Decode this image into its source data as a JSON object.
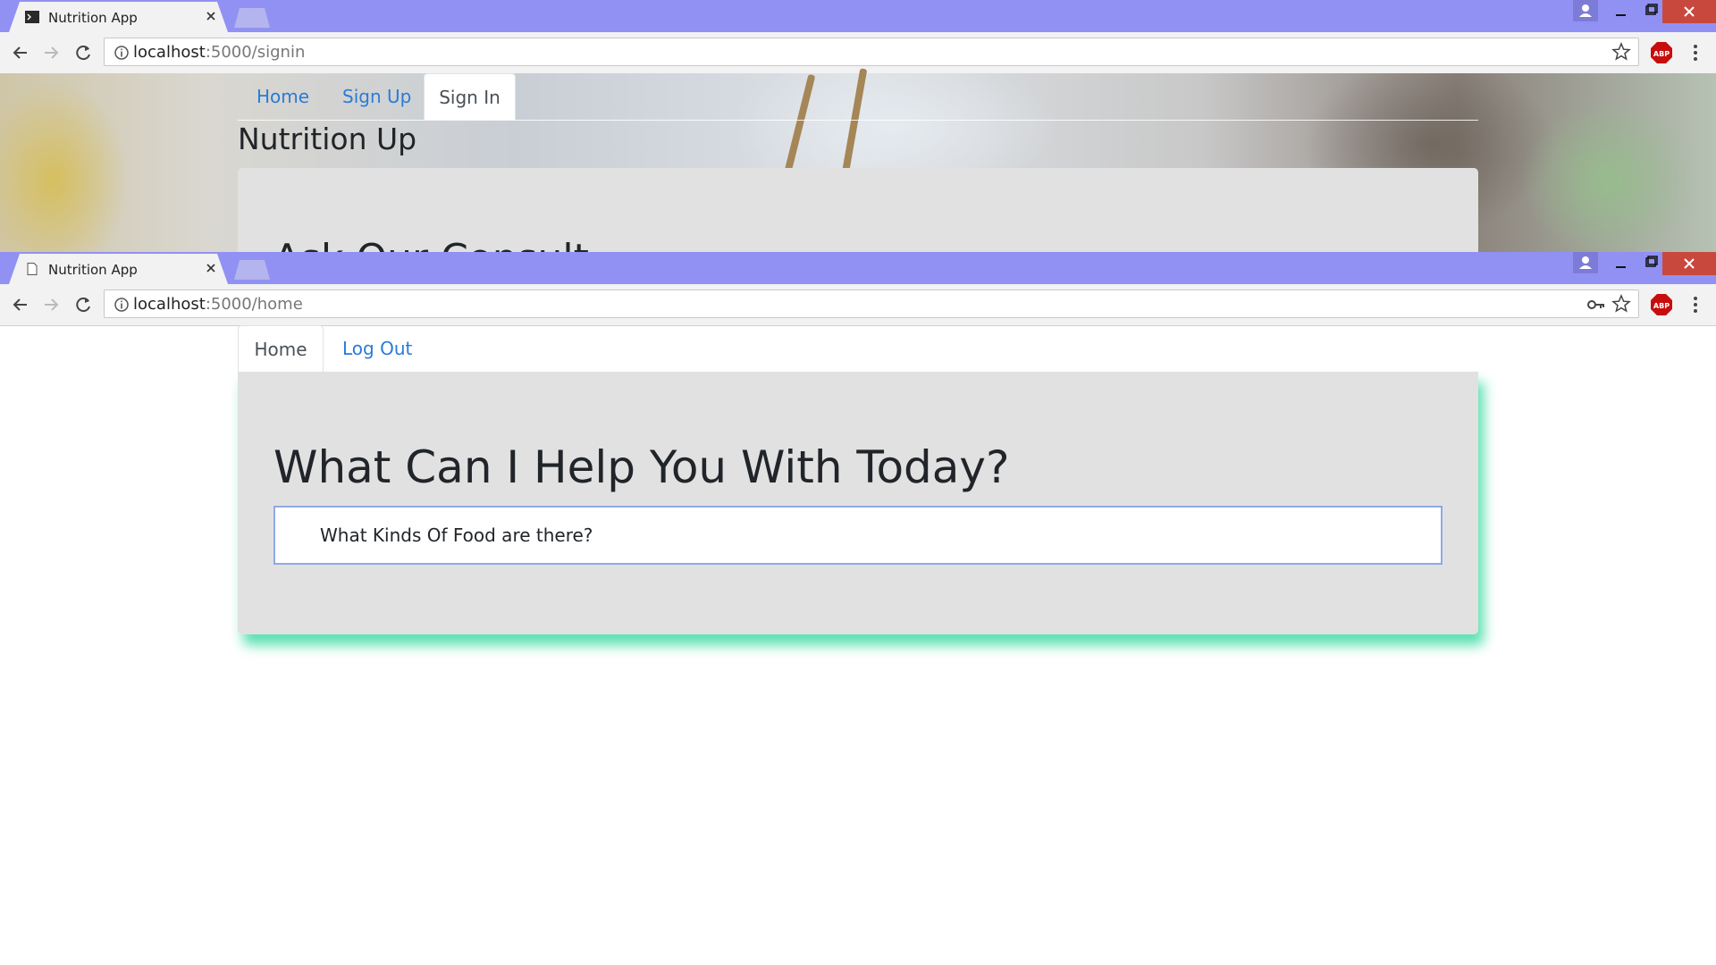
{
  "windows": [
    {
      "tab_title": "Nutrition App",
      "url_host": "localhost",
      "url_path": ":5000/signin",
      "nav": [
        "Home",
        "Sign Up",
        "Sign In"
      ],
      "active_nav": "Sign In",
      "brand": "Nutrition Up",
      "card_heading_partial": "Ask Our Consult"
    },
    {
      "tab_title": "Nutrition App",
      "url_host": "localhost",
      "url_path": ":5000/home",
      "nav": [
        "Home",
        "Log Out"
      ],
      "active_nav": "Home",
      "heading": "What Can I Help You With Today?",
      "query_value": "What Kinds Of Food are there?"
    }
  ],
  "colors": {
    "titlebar": "#9191f4",
    "link": "#2a7bd6",
    "card": "#e1e1e1",
    "card_shadow": "#20d696",
    "close_button": "#c9483e"
  },
  "icons": [
    "back-arrow-icon",
    "forward-arrow-icon",
    "reload-icon",
    "info-icon",
    "star-icon",
    "key-icon",
    "adblock-plus-icon",
    "kebab-menu-icon",
    "user-icon",
    "minimize-icon",
    "maximize-icon",
    "close-icon"
  ]
}
